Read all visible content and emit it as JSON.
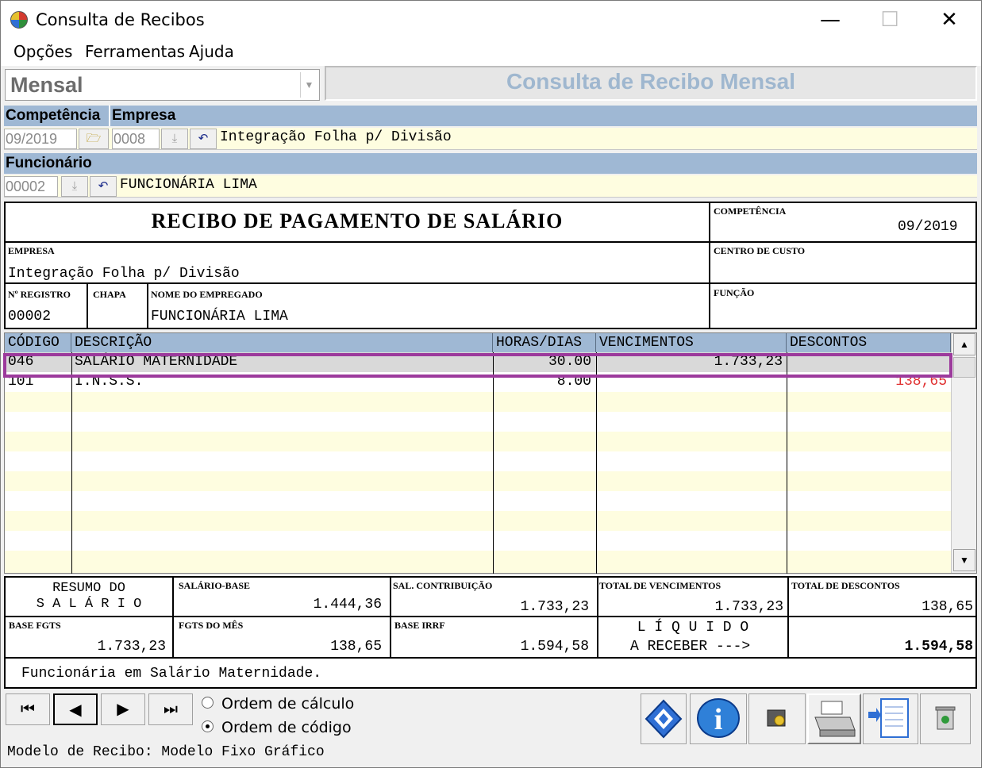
{
  "window": {
    "title": "Consulta de Recibos",
    "minimize": "—",
    "maximize": "☐",
    "close": "✕"
  },
  "menu": [
    "Opções",
    "Ferramentas",
    "Ajuda"
  ],
  "mode": {
    "selected": "Mensal"
  },
  "screen_title": "Consulta de Recibo Mensal",
  "filters": {
    "competencia_label": "Competência",
    "empresa_label": "Empresa",
    "competencia": "09/2019",
    "empresa_code": "0008",
    "empresa_name": "Integração Folha p/ Divisão",
    "funcionario_label": "Funcionário",
    "funcionario_code": "00002",
    "funcionario_name": "FUNCIONÁRIA LIMA"
  },
  "receipt": {
    "title": "RECIBO DE PAGAMENTO DE SALÁRIO",
    "competencia_label": "COMPETÊNCIA",
    "competencia": "09/2019",
    "empresa_label": "EMPRESA",
    "empresa": "Integração Folha p/ Divisão",
    "centro_label": "CENTRO DE CUSTO",
    "registro_label": "Nº REGISTRO",
    "registro": "00002",
    "chapa_label": "CHAPA",
    "nome_label": "NOME DO EMPREGADO",
    "nome": "FUNCIONÁRIA LIMA",
    "funcao_label": "FUNÇÃO"
  },
  "table": {
    "headers": [
      "CÓDIGO",
      "DESCRIÇÃO",
      "HORAS/DIAS",
      "VENCIMENTOS",
      "DESCONTOS"
    ],
    "rows": [
      {
        "codigo": "046",
        "descricao": "SALÁRIO MATERNIDADE",
        "horas": "30.00",
        "vencimentos": "1.733,23",
        "descontos": ""
      },
      {
        "codigo": "101",
        "descricao": "I.N.S.S.",
        "horas": "8.00",
        "vencimentos": "",
        "descontos": "138,65"
      }
    ],
    "discount_color": "#e03030",
    "selection_color": "#9c3a9c"
  },
  "summary": {
    "resumo_line1": "RESUMO DO",
    "resumo_line2": "S A L Á R I O",
    "salario_base_label": "SALÁRIO-BASE",
    "salario_base": "1.444,36",
    "sal_contrib_label": "SAL. CONTRIBUIÇÃO",
    "sal_contrib": "1.733,23",
    "total_venc_label": "TOTAL DE VENCIMENTOS",
    "total_venc": "1.733,23",
    "total_desc_label": "TOTAL DE DESCONTOS",
    "total_desc": "138,65",
    "base_fgts_label": "BASE FGTS",
    "base_fgts": "1.733,23",
    "fgts_mes_label": "FGTS DO MÊS",
    "fgts_mes": "138,65",
    "base_irrf_label": "BASE IRRF",
    "base_irrf": "1.594,58",
    "liquido_line1": "L Í Q U I D O",
    "liquido_line2": "A RECEBER --->",
    "liquido": "1.594,58"
  },
  "note": "Funcionária em Salário Maternidade.",
  "order": {
    "option1": "Ordem de cálculo",
    "option2": "Ordem de código",
    "selected": "Ordem de código"
  },
  "footer": "Modelo de Recibo: Modelo Fixo Gráfico"
}
